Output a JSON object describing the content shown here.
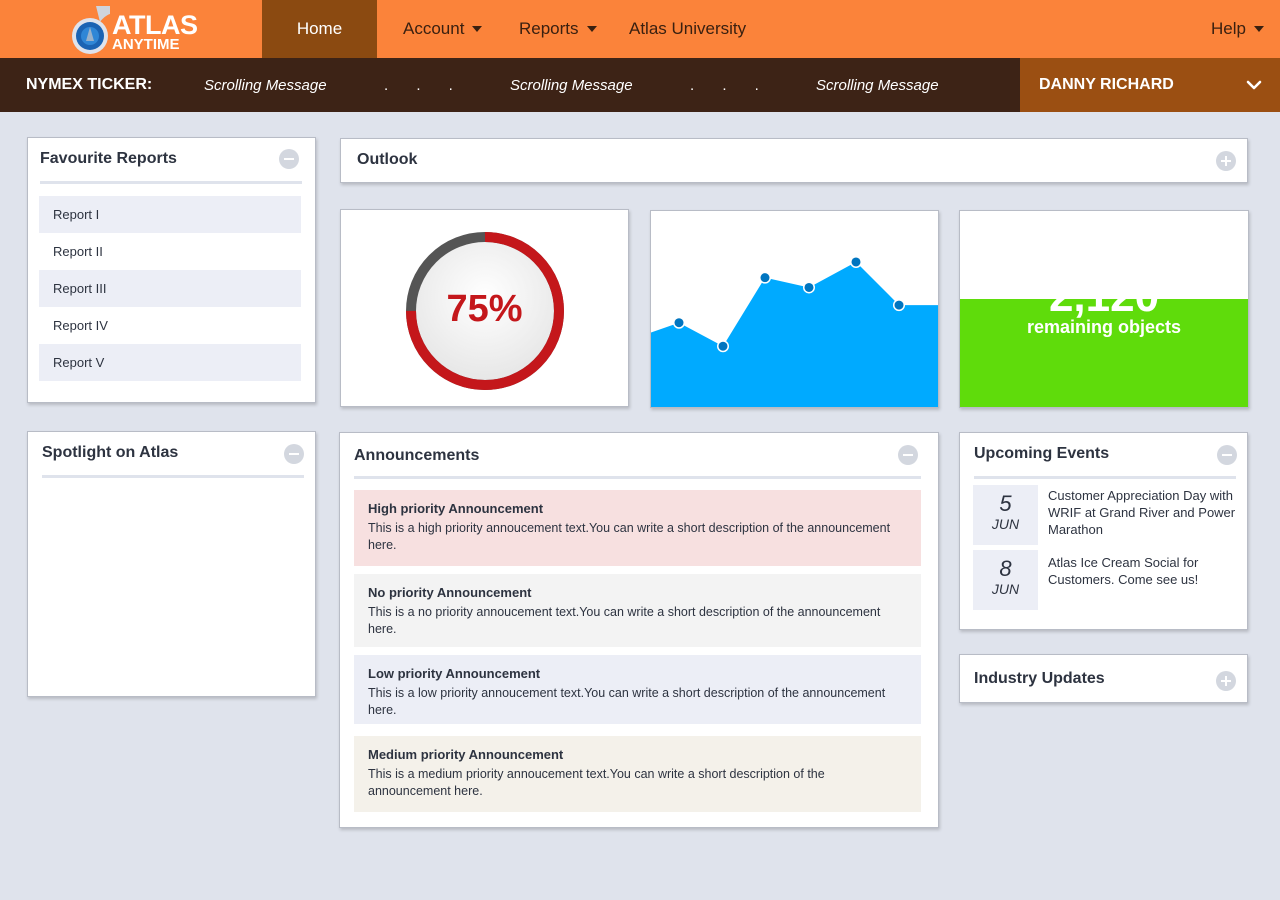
{
  "brand": {
    "line1": "ATLAS",
    "line2": "ANYTIME"
  },
  "nav": {
    "home": "Home",
    "account": "Account",
    "reports": "Reports",
    "university": "Atlas University",
    "help": "Help"
  },
  "ticker": {
    "label": "NYMEX TICKER:",
    "messages": [
      "Scrolling Message",
      "Scrolling Message",
      "Scrolling Message"
    ],
    "separators": [
      ". . .",
      ". . ."
    ]
  },
  "user": {
    "name": "DANNY RICHARD"
  },
  "favourites": {
    "title": "Favourite Reports",
    "items": [
      "Report I",
      "Report II",
      "Report III",
      "Report IV",
      "Report V"
    ]
  },
  "spotlight": {
    "title": "Spotlight on Atlas"
  },
  "outlook": {
    "title": "Outlook"
  },
  "gauge": {
    "percent": 75,
    "label": "75%",
    "color_fill": "#c4171b",
    "color_rest": "#555555"
  },
  "trend": {
    "points": [
      0.43,
      0.31,
      0.66,
      0.61,
      0.74,
      0.52
    ],
    "color": "#00aaff",
    "dot_color": "#0075c0"
  },
  "stat": {
    "value": "2,120",
    "label": "remaining objects",
    "color": "#5fdc0b"
  },
  "announcements": {
    "title": "Announcements",
    "items": [
      {
        "title": "High priority Announcement",
        "text": "This is a high priority annoucement text.You can write a short description of the announcement here.",
        "bg": "#f7e0e0"
      },
      {
        "title": "No priority Announcement",
        "text": "This is a no priority annoucement text.You can write a short description of the announcement here.",
        "bg": "#f3f3f3"
      },
      {
        "title": "Low priority Announcement",
        "text": "This is a low priority annoucement text.You can write a short description of the announcement here.",
        "bg": "#eceef6"
      },
      {
        "title": "Medium priority Announcement",
        "text": "This is a medium priority annoucement text.You can write a short description of the announcement here.",
        "bg": "#f4f1ea"
      }
    ]
  },
  "events": {
    "title": "Upcoming Events",
    "items": [
      {
        "day": "5",
        "month": "JUN",
        "text": "Customer Appreciation Day with WRIF at Grand River and Power Marathon"
      },
      {
        "day": "8",
        "month": "JUN",
        "text": "Atlas Ice Cream Social for Customers.  Come see us!"
      }
    ]
  },
  "industry": {
    "title": "Industry Updates"
  },
  "icons": {
    "logo": "atlas-logo-badge",
    "nav_caret": "caret-down-icon",
    "user_chevron": "chevron-down-icon",
    "collapse": "minus-circle-icon",
    "expand": "plus-circle-icon"
  }
}
